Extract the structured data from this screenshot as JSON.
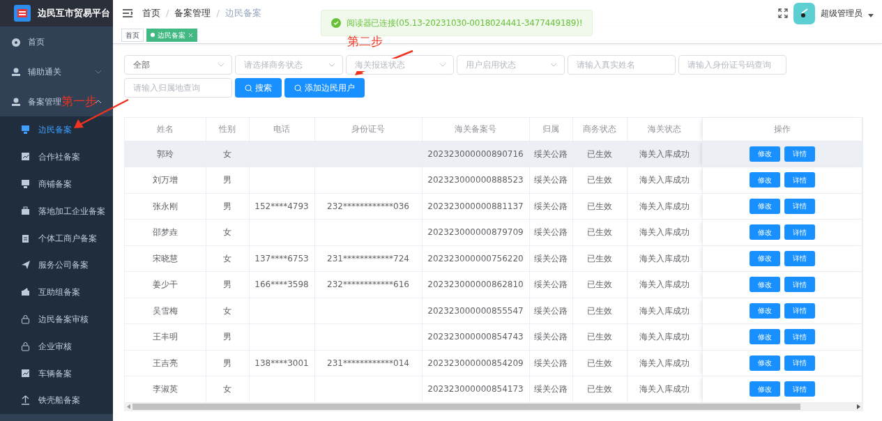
{
  "app": {
    "title": "边民互市贸易平台"
  },
  "sidebar": {
    "items": [
      {
        "label": "首页",
        "selected": false
      },
      {
        "label": "辅助通关",
        "selected": false,
        "expanded": false
      },
      {
        "label": "备案管理",
        "selected": false,
        "expanded": true,
        "children": [
          {
            "label": "边民备案",
            "selected": true
          },
          {
            "label": "合作社备案",
            "selected": false
          },
          {
            "label": "商铺备案",
            "selected": false
          },
          {
            "label": "落地加工企业备案",
            "selected": false
          },
          {
            "label": "个体工商户备案",
            "selected": false
          },
          {
            "label": "服务公司备案",
            "selected": false
          },
          {
            "label": "互助组备案",
            "selected": false
          },
          {
            "label": "边民备案审核",
            "selected": false
          },
          {
            "label": "企业审核",
            "selected": false
          },
          {
            "label": "车辆备案",
            "selected": false
          },
          {
            "label": "铁壳船备案",
            "selected": false
          }
        ]
      }
    ]
  },
  "breadcrumb": [
    {
      "label": "首页",
      "current": false
    },
    {
      "separator": "/",
      "label": "备案管理",
      "current": false
    },
    {
      "separator": "/",
      "label": "边民备案",
      "current": true
    }
  ],
  "tags": [
    {
      "label": "首页",
      "selected": false,
      "closable": false
    },
    {
      "label": "边民备案",
      "selected": true,
      "closable": true
    }
  ],
  "user": {
    "name": "超级管理员"
  },
  "toast": {
    "kind": "success",
    "message": "阅读器已连接(05.13-20231030-0018024441-3477449189)!"
  },
  "filters": [
    {
      "kind": "select",
      "value": "全部"
    },
    {
      "kind": "select",
      "placeholder": "请选择商务状态"
    },
    {
      "kind": "select",
      "placeholder": "海关报送状态"
    },
    {
      "kind": "select",
      "placeholder": "用户启用状态"
    },
    {
      "kind": "input",
      "placeholder": "请输入真实姓名"
    },
    {
      "kind": "input",
      "placeholder": "请输入身份证号码查询"
    },
    {
      "kind": "input",
      "placeholder": "请输入归属地查询"
    }
  ],
  "actions": [
    {
      "label": "搜索"
    },
    {
      "label": "添加边民用户"
    }
  ],
  "table": {
    "columns": [
      "姓名",
      "性别",
      "电话",
      "身份证号",
      "海关备案号",
      "归属",
      "商务状态",
      "海关状态",
      "操作"
    ],
    "rows": [
      {
        "hovered": true,
        "cells": [
          "郭玲",
          "女",
          "",
          "",
          "202323000000890716",
          "绥关公路",
          "已生效",
          "海关入库成功"
        ],
        "actions": [
          "修改",
          "详情"
        ]
      },
      {
        "hovered": false,
        "cells": [
          "刘万增",
          "男",
          "",
          "",
          "202323000000888523",
          "绥关公路",
          "已生效",
          "海关入库成功"
        ],
        "actions": [
          "修改",
          "详情"
        ]
      },
      {
        "hovered": false,
        "cells": [
          "张永刚",
          "男",
          "152****4793",
          "232************036",
          "202323000000881137",
          "绥关公路",
          "已生效",
          "海关入库成功"
        ],
        "actions": [
          "修改",
          "详情"
        ]
      },
      {
        "hovered": false,
        "cells": [
          "邵梦垚",
          "女",
          "",
          "",
          "202323000000879709",
          "绥关公路",
          "已生效",
          "海关入库成功"
        ],
        "actions": [
          "修改",
          "详情"
        ]
      },
      {
        "hovered": false,
        "cells": [
          "宋晓慧",
          "女",
          "137****6753",
          "231************724",
          "202323000000756220",
          "绥关公路",
          "已生效",
          "海关入库成功"
        ],
        "actions": [
          "修改",
          "详情"
        ]
      },
      {
        "hovered": false,
        "cells": [
          "姜少干",
          "男",
          "166****3598",
          "232************616",
          "202323000000862810",
          "绥关公路",
          "已生效",
          "海关入库成功"
        ],
        "actions": [
          "修改",
          "详情"
        ]
      },
      {
        "hovered": false,
        "cells": [
          "吴雪梅",
          "女",
          "",
          "",
          "202323000000855547",
          "绥关公路",
          "已生效",
          "海关入库成功"
        ],
        "actions": [
          "修改",
          "详情"
        ]
      },
      {
        "hovered": false,
        "cells": [
          "王丰明",
          "男",
          "",
          "",
          "202323000000854743",
          "绥关公路",
          "已生效",
          "海关入库成功"
        ],
        "actions": [
          "修改",
          "详情"
        ]
      },
      {
        "hovered": false,
        "cells": [
          "王吉亮",
          "男",
          "138****3001",
          "231************014",
          "202323000000854209",
          "绥关公路",
          "已生效",
          "海关入库成功"
        ],
        "actions": [
          "修改",
          "详情"
        ]
      },
      {
        "hovered": false,
        "cells": [
          "李淑英",
          "女",
          "",
          "",
          "202323000000854173",
          "绥关公路",
          "已生效",
          "海关入库成功"
        ],
        "actions": [
          "修改",
          "详情"
        ]
      }
    ]
  },
  "annotations": [
    {
      "text": "第一步"
    },
    {
      "text": "第二步"
    }
  ]
}
